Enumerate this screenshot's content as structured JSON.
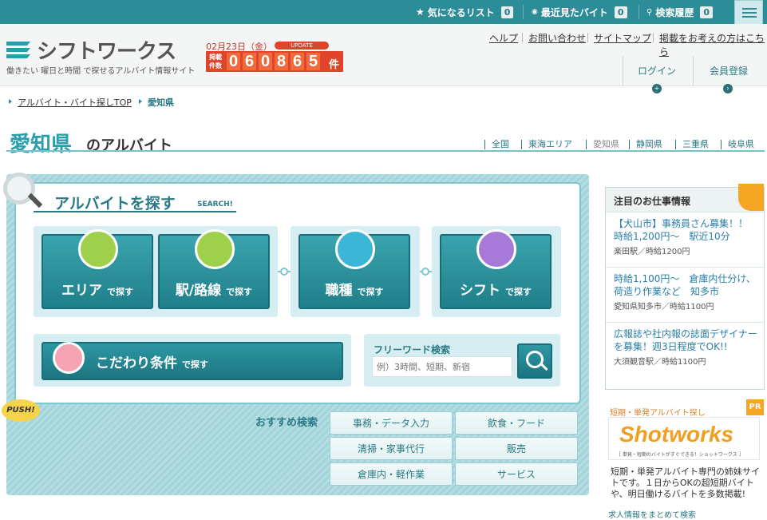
{
  "topbar": {
    "favorites_label": "気になるリスト",
    "favorites_count": "0",
    "recent_label": "最近見たバイト",
    "recent_count": "0",
    "history_label": "検索履歴",
    "history_count": "0"
  },
  "header": {
    "logo": "シフトワークス",
    "tagline": "働きたい 曜日と時間 で探せるアルバイト情報サイト",
    "date": "02月23日（金）",
    "update_badge": "UPDATE",
    "count_label": "掲載件数",
    "count_digits": [
      "0",
      "6",
      "0",
      "8",
      "6",
      "5"
    ],
    "count_unit": "件",
    "links": [
      "ヘルプ",
      "お問い合わせ",
      "サイトマップ",
      "掲載をお考えの方はこちら"
    ],
    "login": "ログイン",
    "register": "会員登録"
  },
  "breadcrumb": [
    "アルバイト・バイト探しTOP",
    "愛知県"
  ],
  "title": {
    "pref": "愛知県",
    "suffix": "のアルバイト",
    "regions": [
      "全国",
      "東海エリア",
      "愛知県",
      "静岡県",
      "三重県",
      "岐阜県"
    ]
  },
  "search": {
    "title": "アルバイトを探す",
    "title_en": "SEARCH!",
    "tiles": [
      {
        "label": "エリア",
        "sub": "で探す"
      },
      {
        "label": "駅/路線",
        "sub": "で探す"
      },
      {
        "label": "職種",
        "sub": "で探す"
      },
      {
        "label": "シフト",
        "sub": "で探す"
      }
    ],
    "kodawari": "こだわり条件",
    "kodawari_sub": "で探す",
    "freeword_title": "フリーワード検索",
    "freeword_placeholder": "例）3時間、短期、新宿",
    "push": "PUSH!",
    "recommend_label": "おすすめ検索",
    "recommend": [
      "事務・データ入力",
      "飲食・フード",
      "清掃・家事代行",
      "販売",
      "倉庫内・軽作業",
      "サービス"
    ]
  },
  "side": {
    "head": "注目のお仕事情報",
    "jobs": [
      {
        "title": "【犬山市】事務員さん募集！！　時給1,200円〜　駅近10分",
        "sub": "楽田駅／時給1200円"
      },
      {
        "title": "時給1,100円〜　倉庫内仕分け、荷造り作業など　知多市",
        "sub": "愛知県知多市／時給1100円"
      },
      {
        "title": "広報誌や社内報の誌面デザイナーを募集！週3日程度でOK!!",
        "sub": "大須観音駅／時給1100円"
      }
    ],
    "pr_head": "短期・単発アルバイト探し",
    "pr_badge": "PR",
    "sw_logo": "Shotworks",
    "sw_sub": "［ 単発・短期のバイトがすぐできる！ショットワークス ］",
    "sw_desc": "短期・単発アルバイト専門の姉妹サイトです。１日からOKの超短期バイトや、明日働けるバイトを多数掲載!",
    "bottom": "求人情報をまとめて検索"
  },
  "colors": {
    "accent": "#2c8c98",
    "orange": "#e0452c"
  }
}
